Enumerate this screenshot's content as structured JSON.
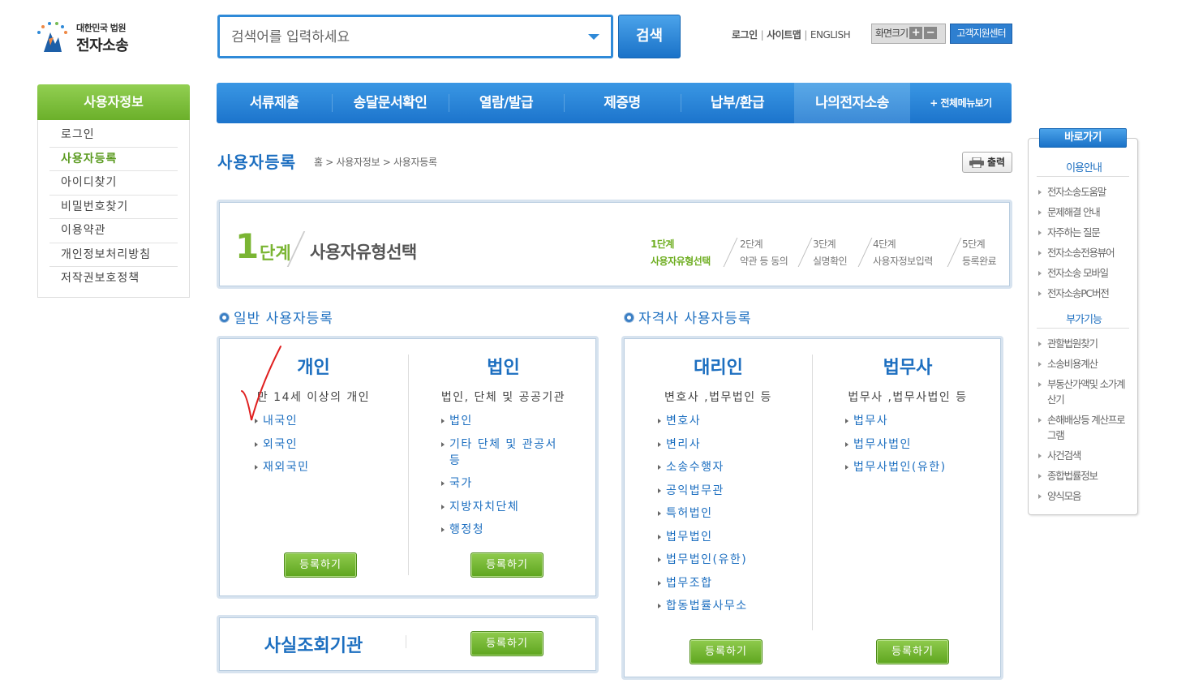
{
  "header": {
    "logo_top": "대한민국 법원",
    "logo_main": "전자소송",
    "search_placeholder": "검색어를 입력하세요",
    "search_button": "검색",
    "links": [
      "로그인",
      "사이트맵",
      "ENGLISH"
    ],
    "font_size_label": "화면크기",
    "font_plus": "+",
    "font_minus": "−",
    "support_center": "고객지원센터"
  },
  "sidebar": {
    "title": "사용자정보",
    "items": [
      "로그인",
      "사용자등록",
      "아이디찾기",
      "비밀번호찾기",
      "이용약관",
      "개인정보처리방침",
      "저작권보호정책"
    ],
    "active_index": 1
  },
  "gnb": {
    "items": [
      "서류제출",
      "송달문서확인",
      "열람/발급",
      "제증명",
      "납부/환급",
      "나의전자소송"
    ],
    "active_index": 5,
    "all_menu": "+ 전체메뉴보기"
  },
  "page": {
    "title": "사용자등록",
    "breadcrumb": "홈 > 사용자정보 > 사용자등록",
    "print": "출력"
  },
  "step": {
    "number": "1",
    "label": "단계",
    "name": "사용자유형선택",
    "steps": [
      {
        "no": "1단계",
        "name": "사용자유형선택"
      },
      {
        "no": "2단계",
        "name": "약관 등 동의"
      },
      {
        "no": "3단계",
        "name": "실명확인"
      },
      {
        "no": "4단계",
        "name": "사용자정보입력"
      },
      {
        "no": "5단계",
        "name": "등록완료"
      }
    ]
  },
  "general": {
    "section_title": "일반 사용자등록",
    "individual": {
      "title": "개인",
      "desc": "만 14세 이상의 개인",
      "links": [
        "내국인",
        "외국인",
        "재외국민"
      ],
      "button": "등록하기"
    },
    "corporate": {
      "title": "법인",
      "desc": "법인, 단체 및 공공기관",
      "links": [
        "법인",
        "기타 단체 및 관공서 등",
        "국가",
        "지방자치단체",
        "행정청"
      ],
      "button": "등록하기"
    },
    "fact_finding": {
      "title": "사실조회기관",
      "button": "등록하기"
    }
  },
  "professional": {
    "section_title": "자격사 사용자등록",
    "agent": {
      "title": "대리인",
      "desc": "변호사 ,법무법인 등",
      "links": [
        "변호사",
        "변리사",
        "소송수행자",
        "공익법무관",
        "특허법인",
        "법무법인",
        "법무법인(유한)",
        "법무조합",
        "합동법률사무소"
      ],
      "button": "등록하기"
    },
    "judicial_scrivener": {
      "title": "법무사",
      "desc": "법무사 ,법무사법인 등",
      "links": [
        "법무사",
        "법무사법인",
        "법무사법인(유한)"
      ],
      "button": "등록하기"
    }
  },
  "quick": {
    "title": "바로가기",
    "usage_title": "이용안내",
    "usage_items": [
      "전자소송도움말",
      "문제해결 안내",
      "자주하는 질문",
      "전자소송전용뷰어",
      "전자소송 모바일",
      "전자소송PC버전"
    ],
    "extra_title": "부가기능",
    "extra_items": [
      "관할법원찾기",
      "소송비용계산",
      "부동산가액및 소가계산기",
      "손해배상등 계산프로그램",
      "사건검색",
      "종합법률정보",
      "양식모음"
    ]
  },
  "colors": {
    "primary_blue": "#1d6fc0",
    "green": "#6bb02a"
  }
}
